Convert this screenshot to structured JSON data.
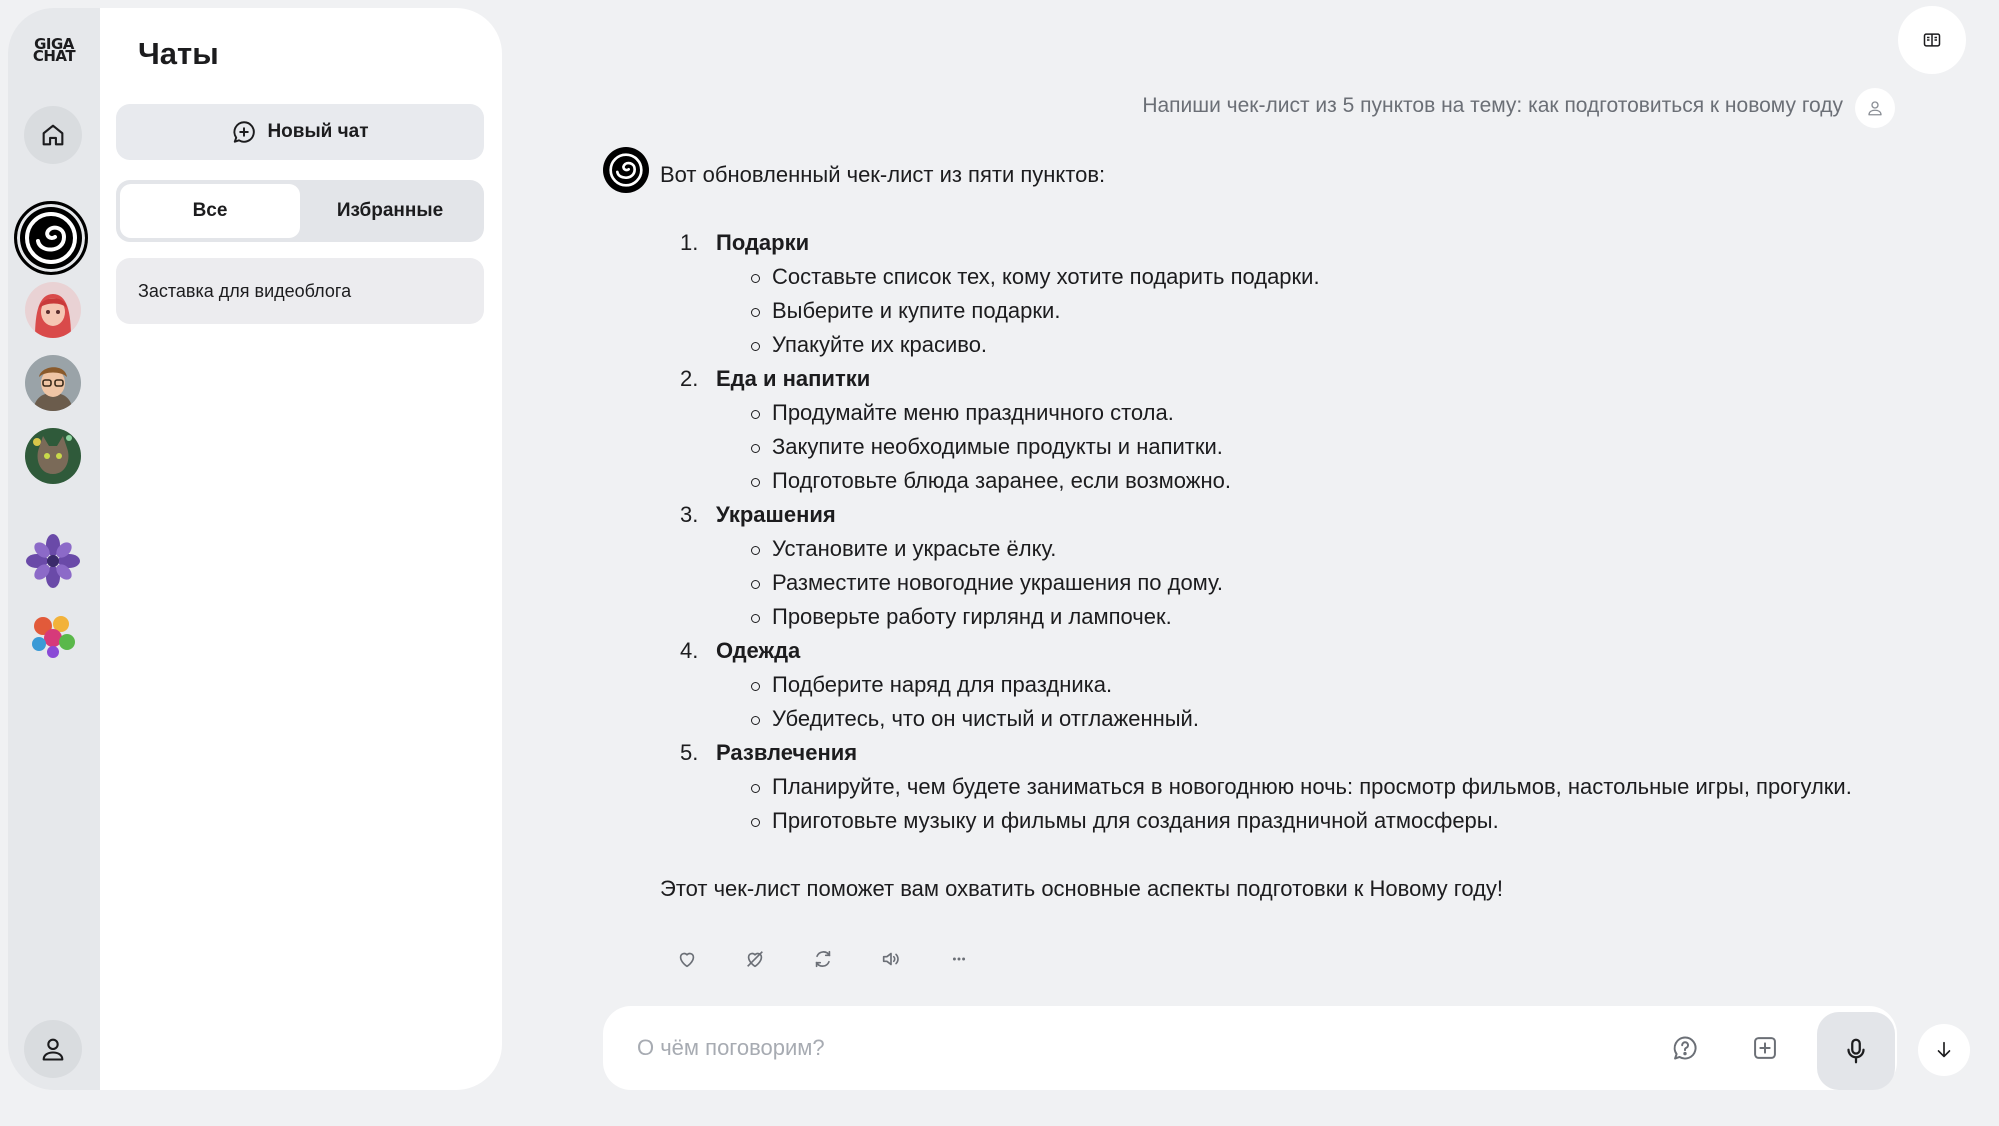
{
  "brand": {
    "logo_text_line1": "GIGA",
    "logo_text_line2": "CHAT"
  },
  "rail": {
    "items": [
      {
        "name": "home-icon"
      },
      {
        "name": "gigachat-avatar"
      },
      {
        "name": "girl-avatar"
      },
      {
        "name": "boy-glasses-avatar"
      },
      {
        "name": "cat-avatar"
      },
      {
        "name": "flower-avatar"
      },
      {
        "name": "colorful-bouquet-avatar"
      }
    ],
    "profile_icon": "user-icon"
  },
  "panel": {
    "title": "Чаты",
    "new_chat_label": "Новый чат",
    "tabs": [
      {
        "label": "Все",
        "active": true
      },
      {
        "label": "Избранные",
        "active": false
      }
    ],
    "chats": [
      {
        "title": "Заставка для видеоблога"
      }
    ]
  },
  "conversation": {
    "user_message": "Напиши чек-лист из 5 пунктов на тему: как подготовиться к новому году",
    "bot_intro": "Вот обновленный чек-лист из пяти пунктов:",
    "steps": [
      {
        "num": "1.",
        "title": "Подарки",
        "items": [
          "Составьте список тех, кому хотите подарить подарки.",
          "Выберите и купите подарки.",
          "Упакуйте их красиво."
        ]
      },
      {
        "num": "2.",
        "title": "Еда и напитки",
        "items": [
          "Продумайте меню праздничного стола.",
          "Закупите необходимые продукты и напитки.",
          "Подготовьте блюда заранее, если возможно."
        ]
      },
      {
        "num": "3.",
        "title": "Украшения",
        "items": [
          "Установите и украсьте ёлку.",
          "Разместите новогодние украшения по дому.",
          "Проверьте работу гирлянд и лампочек."
        ]
      },
      {
        "num": "4.",
        "title": "Одежда",
        "items": [
          "Подберите наряд для праздника.",
          "Убедитесь, что он чистый и отглаженный."
        ]
      },
      {
        "num": "5.",
        "title": "Развлечения",
        "items": [
          "Планируйте, чем будете заниматься в новогоднюю ночь: просмотр фильмов, настольные игры, прогулки.",
          "Приготовьте музыку и фильмы для создания праздничной атмосферы."
        ]
      }
    ],
    "bot_outro": "Этот чек-лист поможет вам охватить основные аспекты подготовки к Новому году!"
  },
  "composer": {
    "placeholder": "О чём поговорим?"
  },
  "colors": {
    "background": "#f0f1f3",
    "panel": "#ffffff",
    "rail": "#e6e8eb",
    "accent": "#000000"
  }
}
